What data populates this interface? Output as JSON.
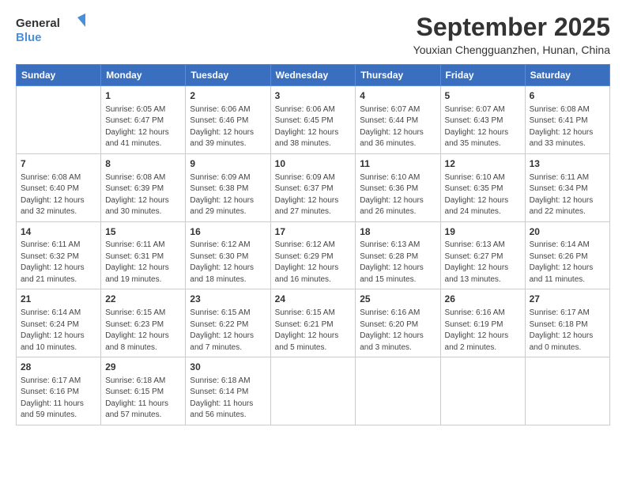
{
  "header": {
    "logo_general": "General",
    "logo_blue": "Blue",
    "title": "September 2025",
    "location": "Youxian Chengguanzhen, Hunan, China"
  },
  "days_of_week": [
    "Sunday",
    "Monday",
    "Tuesday",
    "Wednesday",
    "Thursday",
    "Friday",
    "Saturday"
  ],
  "weeks": [
    [
      {
        "day": "",
        "info": ""
      },
      {
        "day": "1",
        "info": "Sunrise: 6:05 AM\nSunset: 6:47 PM\nDaylight: 12 hours\nand 41 minutes."
      },
      {
        "day": "2",
        "info": "Sunrise: 6:06 AM\nSunset: 6:46 PM\nDaylight: 12 hours\nand 39 minutes."
      },
      {
        "day": "3",
        "info": "Sunrise: 6:06 AM\nSunset: 6:45 PM\nDaylight: 12 hours\nand 38 minutes."
      },
      {
        "day": "4",
        "info": "Sunrise: 6:07 AM\nSunset: 6:44 PM\nDaylight: 12 hours\nand 36 minutes."
      },
      {
        "day": "5",
        "info": "Sunrise: 6:07 AM\nSunset: 6:43 PM\nDaylight: 12 hours\nand 35 minutes."
      },
      {
        "day": "6",
        "info": "Sunrise: 6:08 AM\nSunset: 6:41 PM\nDaylight: 12 hours\nand 33 minutes."
      }
    ],
    [
      {
        "day": "7",
        "info": "Sunrise: 6:08 AM\nSunset: 6:40 PM\nDaylight: 12 hours\nand 32 minutes."
      },
      {
        "day": "8",
        "info": "Sunrise: 6:08 AM\nSunset: 6:39 PM\nDaylight: 12 hours\nand 30 minutes."
      },
      {
        "day": "9",
        "info": "Sunrise: 6:09 AM\nSunset: 6:38 PM\nDaylight: 12 hours\nand 29 minutes."
      },
      {
        "day": "10",
        "info": "Sunrise: 6:09 AM\nSunset: 6:37 PM\nDaylight: 12 hours\nand 27 minutes."
      },
      {
        "day": "11",
        "info": "Sunrise: 6:10 AM\nSunset: 6:36 PM\nDaylight: 12 hours\nand 26 minutes."
      },
      {
        "day": "12",
        "info": "Sunrise: 6:10 AM\nSunset: 6:35 PM\nDaylight: 12 hours\nand 24 minutes."
      },
      {
        "day": "13",
        "info": "Sunrise: 6:11 AM\nSunset: 6:34 PM\nDaylight: 12 hours\nand 22 minutes."
      }
    ],
    [
      {
        "day": "14",
        "info": "Sunrise: 6:11 AM\nSunset: 6:32 PM\nDaylight: 12 hours\nand 21 minutes."
      },
      {
        "day": "15",
        "info": "Sunrise: 6:11 AM\nSunset: 6:31 PM\nDaylight: 12 hours\nand 19 minutes."
      },
      {
        "day": "16",
        "info": "Sunrise: 6:12 AM\nSunset: 6:30 PM\nDaylight: 12 hours\nand 18 minutes."
      },
      {
        "day": "17",
        "info": "Sunrise: 6:12 AM\nSunset: 6:29 PM\nDaylight: 12 hours\nand 16 minutes."
      },
      {
        "day": "18",
        "info": "Sunrise: 6:13 AM\nSunset: 6:28 PM\nDaylight: 12 hours\nand 15 minutes."
      },
      {
        "day": "19",
        "info": "Sunrise: 6:13 AM\nSunset: 6:27 PM\nDaylight: 12 hours\nand 13 minutes."
      },
      {
        "day": "20",
        "info": "Sunrise: 6:14 AM\nSunset: 6:26 PM\nDaylight: 12 hours\nand 11 minutes."
      }
    ],
    [
      {
        "day": "21",
        "info": "Sunrise: 6:14 AM\nSunset: 6:24 PM\nDaylight: 12 hours\nand 10 minutes."
      },
      {
        "day": "22",
        "info": "Sunrise: 6:15 AM\nSunset: 6:23 PM\nDaylight: 12 hours\nand 8 minutes."
      },
      {
        "day": "23",
        "info": "Sunrise: 6:15 AM\nSunset: 6:22 PM\nDaylight: 12 hours\nand 7 minutes."
      },
      {
        "day": "24",
        "info": "Sunrise: 6:15 AM\nSunset: 6:21 PM\nDaylight: 12 hours\nand 5 minutes."
      },
      {
        "day": "25",
        "info": "Sunrise: 6:16 AM\nSunset: 6:20 PM\nDaylight: 12 hours\nand 3 minutes."
      },
      {
        "day": "26",
        "info": "Sunrise: 6:16 AM\nSunset: 6:19 PM\nDaylight: 12 hours\nand 2 minutes."
      },
      {
        "day": "27",
        "info": "Sunrise: 6:17 AM\nSunset: 6:18 PM\nDaylight: 12 hours\nand 0 minutes."
      }
    ],
    [
      {
        "day": "28",
        "info": "Sunrise: 6:17 AM\nSunset: 6:16 PM\nDaylight: 11 hours\nand 59 minutes."
      },
      {
        "day": "29",
        "info": "Sunrise: 6:18 AM\nSunset: 6:15 PM\nDaylight: 11 hours\nand 57 minutes."
      },
      {
        "day": "30",
        "info": "Sunrise: 6:18 AM\nSunset: 6:14 PM\nDaylight: 11 hours\nand 56 minutes."
      },
      {
        "day": "",
        "info": ""
      },
      {
        "day": "",
        "info": ""
      },
      {
        "day": "",
        "info": ""
      },
      {
        "day": "",
        "info": ""
      }
    ]
  ]
}
